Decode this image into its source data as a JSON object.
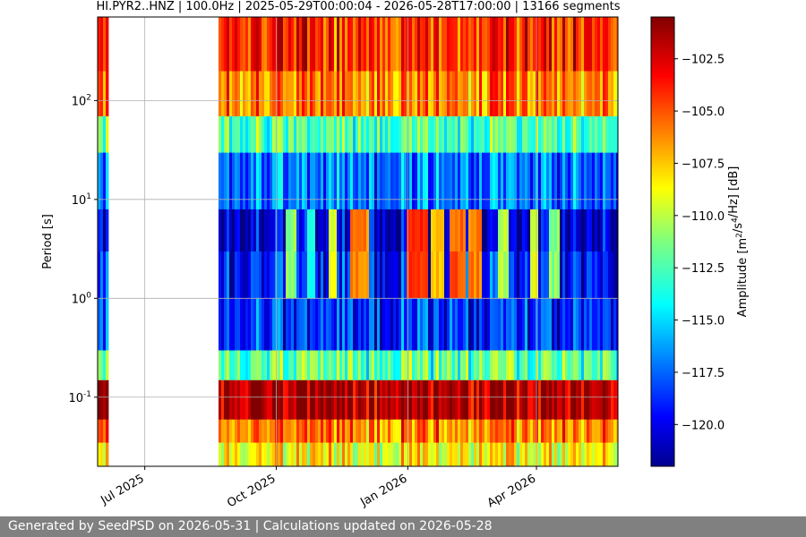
{
  "chart_data": {
    "type": "heatmap",
    "title": "HI.PYR2..HNZ | 100.0Hz | 2025-05-29T00:00:04 - 2026-05-28T17:00:00 | 13166 segments",
    "xlabel": "",
    "ylabel": "Period [s]",
    "x_axis": {
      "type": "date",
      "range": [
        "2025-05-29",
        "2026-05-28"
      ],
      "ticks": [
        {
          "date": "2025-07-01",
          "label": "Jul 2025"
        },
        {
          "date": "2025-10-01",
          "label": "Oct 2025"
        },
        {
          "date": "2026-01-01",
          "label": "Jan 2026"
        },
        {
          "date": "2026-04-01",
          "label": "Apr 2026"
        }
      ]
    },
    "y_axis": {
      "scale": "log",
      "inverted": true,
      "range": [
        0.02,
        700
      ],
      "ticks": [
        {
          "value": 0.1,
          "label": "10^-1"
        },
        {
          "value": 1,
          "label": "10^0"
        },
        {
          "value": 10,
          "label": "10^1"
        },
        {
          "value": 100,
          "label": "10^2"
        }
      ]
    },
    "grid": true,
    "colorbar": {
      "label": "Amplitude [m^2/s^4/Hz] [dB]",
      "colormap": "jet",
      "range": [
        -122,
        -100.5
      ],
      "ticks": [
        -102.5,
        -105.0,
        -107.5,
        -110.0,
        -112.5,
        -115.0,
        -117.5,
        -120.0
      ]
    },
    "data_gaps": [
      {
        "start": "2025-06-05",
        "end": "2025-08-21"
      }
    ],
    "noise_bands": [
      {
        "period_min": 0.02,
        "period_max": 0.035,
        "amplitude_db": -108.5
      },
      {
        "period_min": 0.035,
        "period_max": 0.06,
        "amplitude_db": -106
      },
      {
        "period_min": 0.06,
        "period_max": 0.15,
        "amplitude_db": -101.5
      },
      {
        "period_min": 0.15,
        "period_max": 0.3,
        "amplitude_db": -112
      },
      {
        "period_min": 0.3,
        "period_max": 1.0,
        "amplitude_db": -118.5
      },
      {
        "period_min": 1.0,
        "period_max": 3.0,
        "amplitude_db": -119
      },
      {
        "period_min": 3.0,
        "period_max": 8.0,
        "amplitude_db": -120.5
      },
      {
        "period_min": 8.0,
        "period_max": 30.0,
        "amplitude_db": -117
      },
      {
        "period_min": 30.0,
        "period_max": 70.0,
        "amplitude_db": -112.5
      },
      {
        "period_min": 70.0,
        "period_max": 200.0,
        "amplitude_db": -106
      },
      {
        "period_min": 200.0,
        "period_max": 700.0,
        "amplitude_db": -104
      }
    ],
    "microseism_events": [
      {
        "start": "2025-10-08",
        "end": "2025-10-16",
        "amplitude_db": -111
      },
      {
        "start": "2025-10-22",
        "end": "2025-10-29",
        "amplitude_db": -113
      },
      {
        "start": "2025-11-06",
        "end": "2025-11-13",
        "amplitude_db": -109
      },
      {
        "start": "2025-11-22",
        "end": "2025-12-04",
        "amplitude_db": -106
      },
      {
        "start": "2026-01-01",
        "end": "2026-01-15",
        "amplitude_db": -104
      },
      {
        "start": "2026-01-17",
        "end": "2026-01-27",
        "amplitude_db": -107
      },
      {
        "start": "2026-01-31",
        "end": "2026-02-10",
        "amplitude_db": -105
      },
      {
        "start": "2026-02-12",
        "end": "2026-02-22",
        "amplitude_db": -106
      },
      {
        "start": "2026-03-05",
        "end": "2026-03-12",
        "amplitude_db": -110
      },
      {
        "start": "2026-03-28",
        "end": "2026-04-03",
        "amplitude_db": -109
      },
      {
        "start": "2026-04-10",
        "end": "2026-04-17",
        "amplitude_db": -111
      }
    ]
  },
  "footer": {
    "text": "Generated by SeedPSD on 2026-05-31 | Calculations updated on 2026-05-28"
  }
}
